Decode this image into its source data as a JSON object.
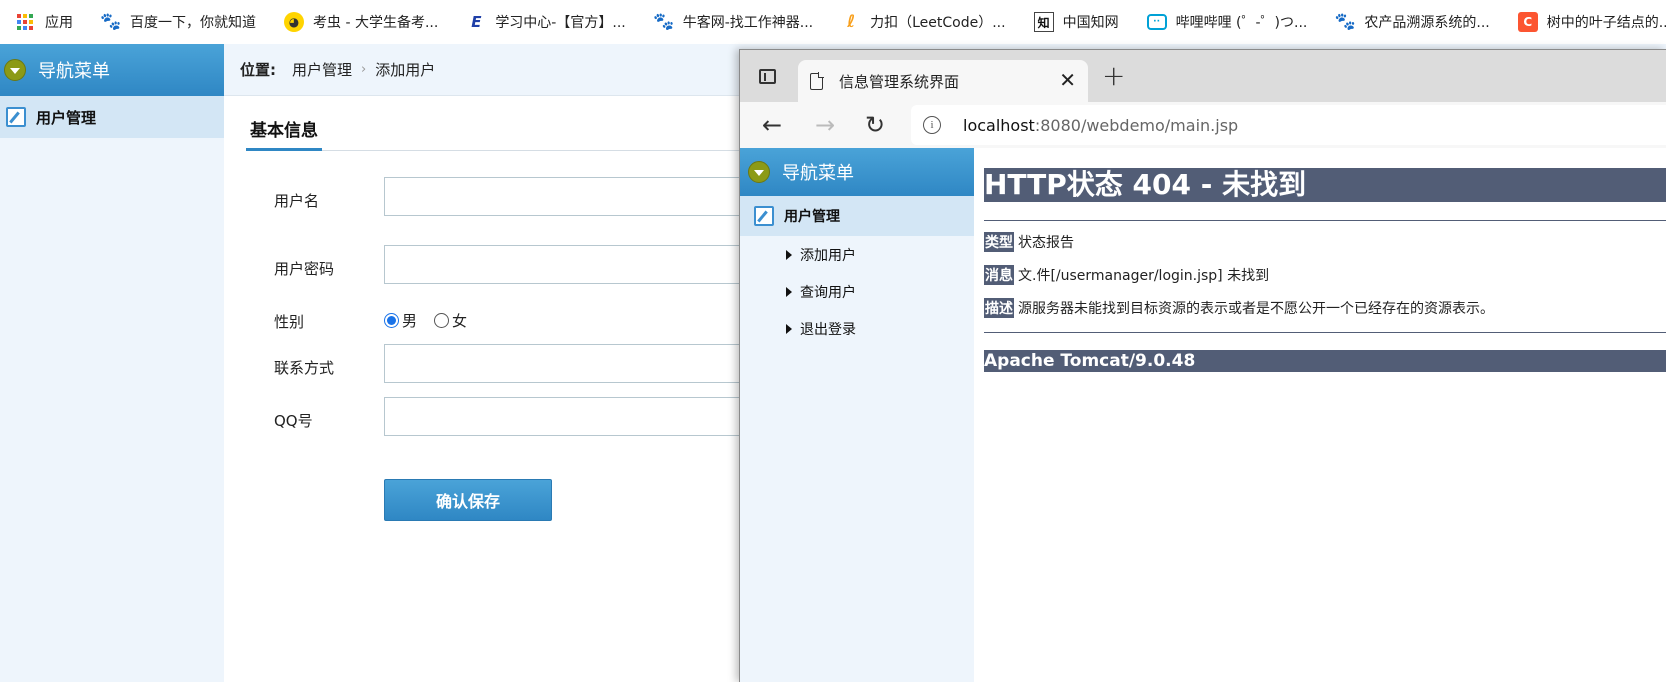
{
  "bookmarks": [
    {
      "label": "应用",
      "icon": "apps-grid-icon"
    },
    {
      "label": "百度一下，你就知道",
      "icon": "baidu-paw-icon"
    },
    {
      "label": "考虫 - 大学生备考...",
      "icon": "kaochong-icon"
    },
    {
      "label": "学习中心-【官方】...",
      "icon": "study-center-icon"
    },
    {
      "label": "牛客网-找工作神器...",
      "icon": "baidu-paw-icon"
    },
    {
      "label": "力扣（LeetCode）...",
      "icon": "leetcode-icon"
    },
    {
      "label": "中国知网",
      "icon": "cnki-icon"
    },
    {
      "label": "哔哩哔哩 (゜-゜)つ...",
      "icon": "bilibili-icon"
    },
    {
      "label": "农产品溯源系统的...",
      "icon": "baidu-paw-icon"
    },
    {
      "label": "树中的叶子结点的...",
      "icon": "csdn-icon"
    }
  ],
  "bg_app": {
    "sidebar": {
      "title": "导航菜单",
      "item": "用户管理"
    },
    "breadcrumb": {
      "label": "位置:",
      "parent": "用户管理",
      "sep": "›",
      "current": "添加用户"
    },
    "tab": "基本信息",
    "form": {
      "username_label": "用户名",
      "password_label": "用户密码",
      "gender_label": "性别",
      "gender_male": "男",
      "gender_female": "女",
      "contact_label": "联系方式",
      "qq_label": "QQ号",
      "save_button": "确认保存"
    }
  },
  "browser": {
    "tab_title": "信息管理系统界面",
    "tab_close": "✕",
    "new_tab": "+",
    "back": "←",
    "forward": "→",
    "reload": "↻",
    "info": "i",
    "url_host": "localhost",
    "url_rest": ":8080/webdemo/main.jsp"
  },
  "inner_app": {
    "sidebar_title": "导航菜单",
    "section": "用户管理",
    "items": [
      "添加用户",
      "查询用户",
      "退出登录"
    ]
  },
  "error_page": {
    "title": "HTTP状态 404 - 未找到",
    "type_label": "类型",
    "type_value": "状态报告",
    "message_label": "消息",
    "message_value": "文.件[/usermanager/login.jsp] 未找到",
    "desc_label": "描述",
    "desc_value": "源服务器未能找到目标资源的表示或者是不愿公开一个已经存在的资源表示。",
    "footer": "Apache Tomcat/9.0.48"
  },
  "colors": {
    "nav_blue": "#2f87c4",
    "sidebar_bg": "#eef5fc",
    "tomcat_header": "#525d76"
  }
}
